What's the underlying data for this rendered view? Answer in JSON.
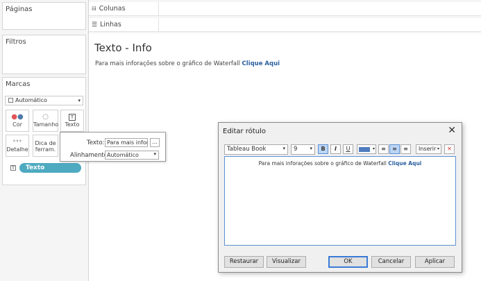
{
  "cards": {
    "paginas": "Páginas",
    "filtros": "Filtros",
    "marcas": "Marcas"
  },
  "marks": {
    "type": "Automático",
    "buttons": [
      {
        "label": "Cor",
        "icon": "color-dots-icon"
      },
      {
        "label": "Tamanho",
        "icon": "size-icon"
      },
      {
        "label": "Texto",
        "icon": "text-icon"
      },
      {
        "label": "Detalhe",
        "icon": "detail-icon"
      },
      {
        "label": "Dica de ferram.",
        "icon": "tooltip-icon"
      }
    ],
    "pill": "Texto"
  },
  "shelves": {
    "colunas": "Colunas",
    "linhas": "Linhas"
  },
  "viz": {
    "title": "Texto - Info",
    "text": "Para mais inforações sobre o gráfico de Waterfall",
    "link": "Clique Aqui"
  },
  "popup": {
    "texto_label": "Texto:",
    "texto_value": "Para mais infora",
    "more": "...",
    "align_label": "Alinhamento:",
    "align_value": "Automático"
  },
  "dialog": {
    "title": "Editar rótulo",
    "font": "Tableau Book",
    "size": "9",
    "bold": "B",
    "italic": "I",
    "underline": "U",
    "insert": "Inserir",
    "content_text": "Para mais inforações sobre o gráfico de Waterfall",
    "content_link": "Clique Aqui",
    "restore": "Restaurar",
    "preview": "Visualizar",
    "ok": "OK",
    "cancel": "Cancelar",
    "apply": "Aplicar",
    "accent": "#4f7cbf"
  }
}
